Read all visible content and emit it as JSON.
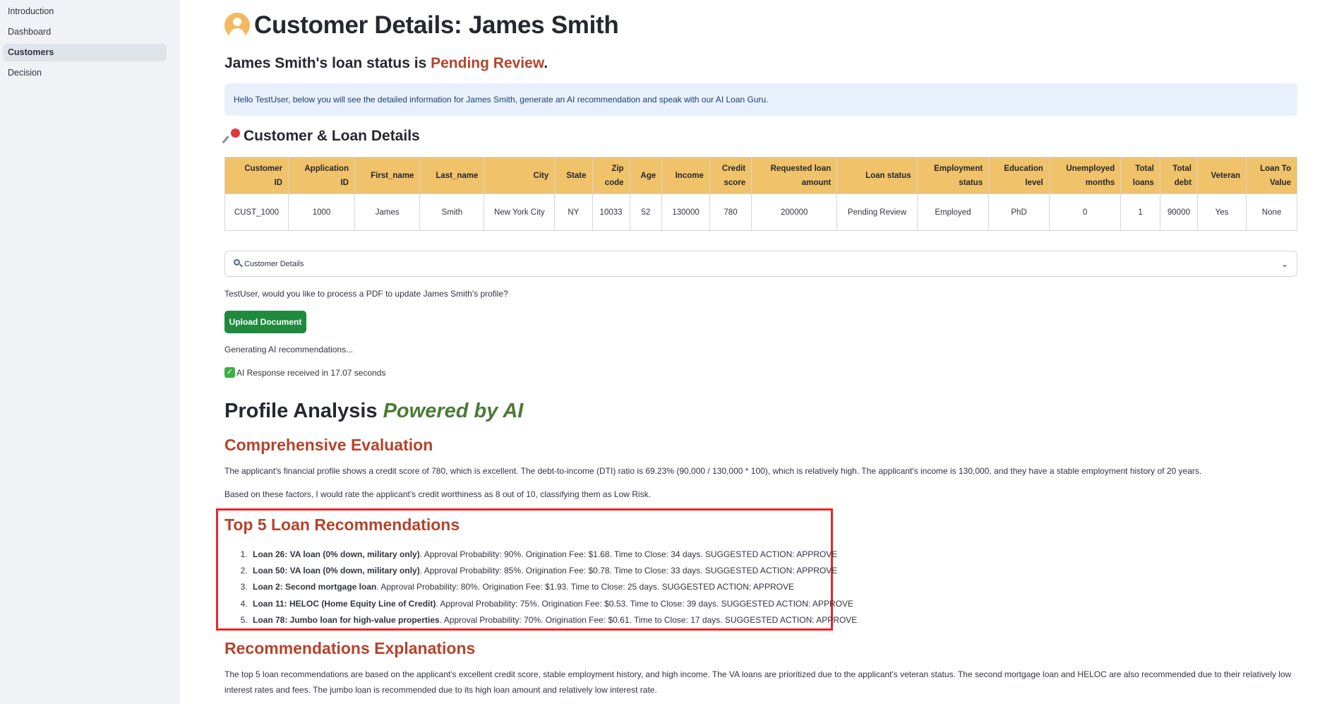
{
  "sidebar": {
    "items": [
      {
        "label": "Introduction"
      },
      {
        "label": "Dashboard"
      },
      {
        "label": "Customers"
      },
      {
        "label": "Decision"
      }
    ],
    "active": "Customers"
  },
  "page": {
    "title": "Customer Details: James Smith",
    "status_prefix": "James Smith's loan status is ",
    "status_value": "Pending Review",
    "status_suffix": ".",
    "info_text": "Hello TestUser, below you will see the detailed information for James Smith, generate an AI recommendation and speak with our AI Loan Guru.",
    "section_title": "Customer & Loan Details"
  },
  "table": {
    "headers": [
      [
        "Customer",
        "ID"
      ],
      [
        "Application",
        "ID"
      ],
      [
        "First_name"
      ],
      [
        "Last_name"
      ],
      [
        "City"
      ],
      [
        "State"
      ],
      [
        "Zip",
        "code"
      ],
      [
        "Age"
      ],
      [
        "Income"
      ],
      [
        "Credit",
        "score"
      ],
      [
        "Requested loan",
        "amount"
      ],
      [
        "Loan status"
      ],
      [
        "Employment",
        "status"
      ],
      [
        "Education",
        "level"
      ],
      [
        "Unemployed",
        "months"
      ],
      [
        "Total",
        "loans"
      ],
      [
        "Total",
        "debt"
      ],
      [
        "Veteran"
      ],
      [
        "Loan To",
        "Value"
      ]
    ],
    "row": [
      "CUST_1000",
      "1000",
      "James",
      "Smith",
      "New York City",
      "NY",
      "10033",
      "52",
      "130000",
      "780",
      "200000",
      "Pending Review",
      "Employed",
      "PhD",
      "0",
      "1",
      "90000",
      "Yes",
      "None"
    ]
  },
  "expander": {
    "label": "Customer Details"
  },
  "upload": {
    "prompt": "TestUser, would you like to process a PDF to update James Smith's profile?",
    "button_label": "Upload Document"
  },
  "ai": {
    "generating": "Generating AI recommendations...",
    "response": "AI Response received in 17.07 seconds"
  },
  "profile": {
    "title_main": "Profile Analysis ",
    "title_ai": "Powered by AI",
    "eval_heading": "Comprehensive Evaluation",
    "eval_p1": "The applicant's financial profile shows a credit score of 780, which is excellent. The debt-to-income (DTI) ratio is 69.23% (90,000 / 130,000 * 100), which is relatively high. The applicant's income is 130,000, and they have a stable employment history of 20 years.",
    "eval_p2": "Based on these factors, I would rate the applicant's credit worthiness as 8 out of 10, classifying them as Low Risk.",
    "recs_heading": "Top 5 Loan Recommendations",
    "recs": [
      {
        "name": "Loan 26: VA loan (0% down, military only)",
        "detail": ". Approval Probability: 90%. Origination Fee: $1.68. Time to Close: 34 days. SUGGESTED ACTION: APPROVE"
      },
      {
        "name": "Loan 50: VA loan (0% down, military only)",
        "detail": ". Approval Probability: 85%. Origination Fee: $0.78. Time to Close: 33 days. SUGGESTED ACTION: APPROVE"
      },
      {
        "name": "Loan 2: Second mortgage loan",
        "detail": ". Approval Probability: 80%. Origination Fee: $1.93. Time to Close: 25 days. SUGGESTED ACTION: APPROVE"
      },
      {
        "name": "Loan 11: HELOC (Home Equity Line of Credit)",
        "detail": ". Approval Probability: 75%. Origination Fee: $0.53. Time to Close: 39 days. SUGGESTED ACTION: APPROVE"
      },
      {
        "name": "Loan 78: Jumbo loan for high-value properties",
        "detail": ". Approval Probability: 70%. Origination Fee: $0.61. Time to Close: 17 days. SUGGESTED ACTION: APPROVE"
      }
    ],
    "expl_heading": "Recommendations Explanations",
    "expl_p": "The top 5 loan recommendations are based on the applicant's excellent credit score, stable employment history, and high income. The VA loans are prioritized due to the applicant's veteran status. The second mortgage loan and HELOC are also recommended due to their relatively low interest rates and fees. The jumbo loan is recommended due to its high loan amount and relatively low interest rate."
  },
  "colors": {
    "accent_red": "#b5432a",
    "table_header": "#f0c26a",
    "button_green": "#1f8a3e",
    "ai_green": "#4c7a36",
    "highlight_box": "#e8262a"
  },
  "icons": {
    "title": "user-avatar-icon",
    "section": "pushpin-icon",
    "expander": "magnifier-icon",
    "expander_toggle": "chevron-down-icon",
    "response": "check-mark-icon"
  }
}
